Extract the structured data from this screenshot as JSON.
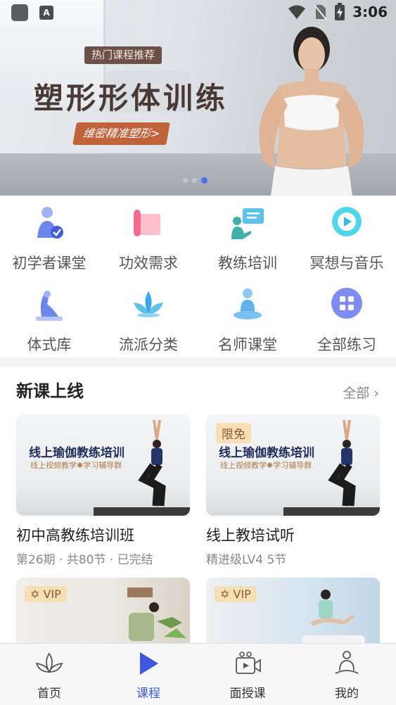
{
  "status_bar": {
    "time": "3:06",
    "a_badge": "A"
  },
  "banner": {
    "tag": "热门课程推荐",
    "title": "塑形形体训练",
    "subtitle": "维密精准塑形>",
    "carousel_total": 3,
    "carousel_active": 3
  },
  "categories": [
    {
      "label": "初学者课堂",
      "icon": "beginner-icon"
    },
    {
      "label": "功效需求",
      "icon": "yoga-mat-icon"
    },
    {
      "label": "教练培训",
      "icon": "coach-training-icon"
    },
    {
      "label": "冥想与音乐",
      "icon": "music-play-icon"
    },
    {
      "label": "体式库",
      "icon": "pose-library-icon"
    },
    {
      "label": "流派分类",
      "icon": "lotus-icon"
    },
    {
      "label": "名师课堂",
      "icon": "meditation-icon"
    },
    {
      "label": "全部练习",
      "icon": "grid-icon"
    }
  ],
  "new_courses": {
    "title": "新课上线",
    "more": "全部",
    "cards": [
      {
        "thumb_title": "线上瑜伽教练培训",
        "thumb_subtitle": "线上视频教学✺学习辅导群",
        "name": "初中高教练培训班",
        "meta": "第26期 · 共80节 · 已完结",
        "badge": ""
      },
      {
        "thumb_title": "线上瑜伽教练培训",
        "thumb_subtitle": "线上视频教学✺学习辅导群",
        "name": "线上教培试听",
        "meta": "精进级LV4   5节",
        "badge": "限免"
      }
    ],
    "vip_cards": [
      {
        "badge": "VIP"
      },
      {
        "badge": "VIP"
      }
    ]
  },
  "tabbar": {
    "items": [
      {
        "label": "首页",
        "icon": "lotus-home-icon"
      },
      {
        "label": "课程",
        "icon": "play-icon"
      },
      {
        "label": "面授课",
        "icon": "video-camera-icon"
      },
      {
        "label": "我的",
        "icon": "profile-icon"
      }
    ],
    "active_index": 1
  },
  "colors": {
    "accent": "#3f57e0",
    "banner_tag": "#6b5048",
    "banner_subtitle": "#c0623a",
    "badge_gold": "#f5dfb5"
  }
}
